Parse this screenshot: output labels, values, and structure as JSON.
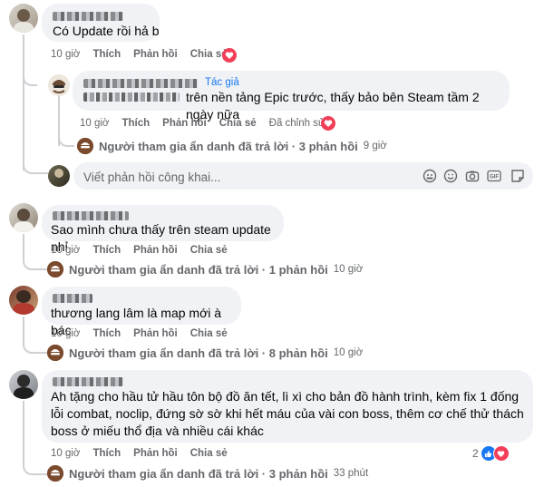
{
  "colors": {
    "bubble": "#f0f2f5",
    "meta": "#65676b",
    "heart": "#f33e58",
    "like": "#1877f2",
    "author_tag": "#1877f2"
  },
  "comments": [
    {
      "text": "Có Update rồi hả b",
      "time": "10 giờ",
      "like": "Thích",
      "reply": "Phản hồi",
      "share": "Chia sẻ",
      "reaction": "heart-icon",
      "nested": {
        "author_tag": "Tác giả",
        "text": "trên nền tảng Epic trước, thấy bảo bên Steam tầm 2 ngày nữa",
        "time": "10 giờ",
        "like": "Thích",
        "reply": "Phản hồi",
        "share": "Chia sẻ",
        "edited": "Đã chỉnh sửa",
        "reaction": "heart-icon",
        "replies_summary": {
          "label": "Người tham gia ẩn danh đã trả lời · 3 phản hồi",
          "time": "9 giờ"
        }
      },
      "write_placeholder": "Viết phản hồi công khai...",
      "write_icons": [
        "emoji-sticker-icon",
        "emoji-icon",
        "camera-icon",
        "gif-icon",
        "sticker-icon"
      ]
    },
    {
      "text": "Sao mình chưa thấy trên steam update nhỉ",
      "time": "10 giờ",
      "like": "Thích",
      "reply": "Phản hồi",
      "share": "Chia sẻ",
      "replies_summary": {
        "label": "Người tham gia ẩn danh đã trả lời · 1 phản hồi",
        "time": "10 giờ"
      }
    },
    {
      "text": "thương lang lâm là map mới à bác",
      "time": "10 giờ",
      "like": "Thích",
      "reply": "Phản hồi",
      "share": "Chia sẻ",
      "replies_summary": {
        "label": "Người tham gia ẩn danh đã trả lời · 8 phản hồi",
        "time": "10 giờ"
      }
    },
    {
      "text_lines": [
        "Ah tặng cho hầu tử hầu tôn bộ đồ ăn tết, lì xì cho bản đồ hành trình, kèm fix 1 đống",
        "lỗi combat, noclip, đứng sờ sờ khi hết máu của vài con boss, thêm cơ chế thử thách",
        "boss ở miếu thổ địa và nhiều cái khác"
      ],
      "time": "10 giờ",
      "like": "Thích",
      "reply": "Phản hồi",
      "share": "Chia sẻ",
      "reaction_count": "2",
      "reactions": [
        "like-icon",
        "heart-icon"
      ],
      "replies_summary": {
        "label": "Người tham gia ẩn danh đã trả lời · 3 phản hồi",
        "time": "33 phút"
      }
    }
  ]
}
